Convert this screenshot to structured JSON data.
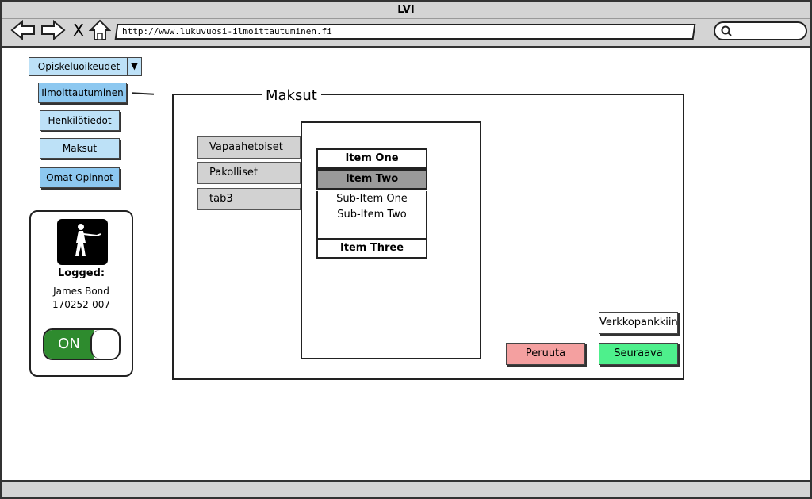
{
  "window": {
    "title": "LVI"
  },
  "browser": {
    "url": "http://www.lukuvuosi-ilmoittautuminen.fi",
    "close_glyph": "X"
  },
  "sidebar": {
    "dropdown_label": "Opiskeluoikeudet",
    "items": [
      {
        "label": "Ilmoittautuminen"
      },
      {
        "label": "Henkilötiedot"
      },
      {
        "label": "Maksut"
      },
      {
        "label": "Omat Opinnot"
      }
    ]
  },
  "user": {
    "logged_label": "Logged:",
    "name": "James Bond",
    "id": "170252-007",
    "toggle_label": "ON"
  },
  "main": {
    "title": "Maksut",
    "tabs": [
      {
        "label": "Vapaahetoiset"
      },
      {
        "label": "Pakolliset"
      },
      {
        "label": "tab3"
      }
    ],
    "accordion": {
      "items": [
        {
          "label": "Item One"
        },
        {
          "label": "Item Two",
          "selected": true,
          "sub_items": [
            "Sub-Item One",
            "Sub-Item Two"
          ]
        },
        {
          "label": "Item Three"
        }
      ]
    },
    "buttons": {
      "bank": "Verkkopankkiin",
      "cancel": "Peruuta",
      "next": "Seuraava"
    }
  },
  "colors": {
    "sidebar_button": "#bde1f7",
    "sidebar_active": "#8dc8f0",
    "cancel": "#f4a0a0",
    "next": "#4ef08c",
    "toggle_on": "#2e8b2e"
  }
}
